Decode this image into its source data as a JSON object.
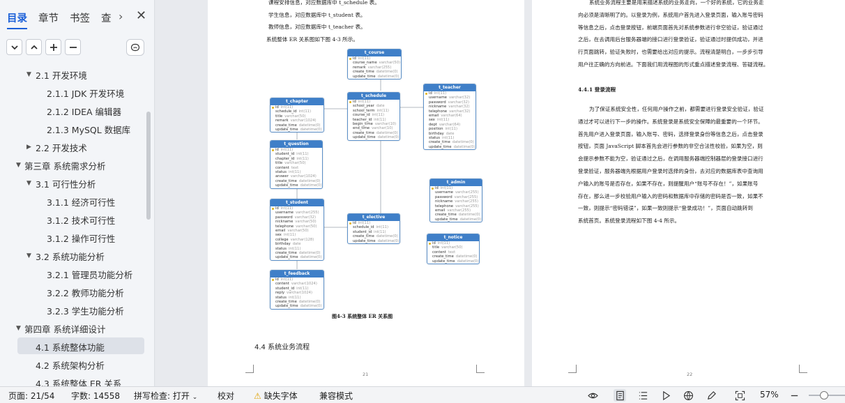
{
  "sidebar": {
    "tabs": [
      {
        "label": "目录"
      },
      {
        "label": "章节"
      },
      {
        "label": "书签"
      },
      {
        "label": "查"
      }
    ],
    "toc": [
      {
        "label": "2.1  开发环境",
        "level": 2,
        "expanded": true
      },
      {
        "label": "2.1.1 JDK 开发环境",
        "level": 3
      },
      {
        "label": "2.1.2 IDEA 编辑器",
        "level": 3
      },
      {
        "label": "2.1.3 MySQL 数据库",
        "level": 3
      },
      {
        "label": "2.2  开发技术",
        "level": 2,
        "expanded": false
      },
      {
        "label": "第三章  系统需求分析",
        "level": 1,
        "expanded": true
      },
      {
        "label": "3.1  可行性分析",
        "level": 2,
        "expanded": true
      },
      {
        "label": "3.1.1  经济可行性",
        "level": 3
      },
      {
        "label": "3.1.2  技术可行性",
        "level": 3
      },
      {
        "label": "3.1.2  操作可行性",
        "level": 3
      },
      {
        "label": "3.2  系统功能分析",
        "level": 2,
        "expanded": true
      },
      {
        "label": "3.2.1  管理员功能分析",
        "level": 3
      },
      {
        "label": "3.2.2  教师功能分析",
        "level": 3
      },
      {
        "label": "3.2.3  学生功能分析",
        "level": 3
      },
      {
        "label": "第四章  系统详细设计",
        "level": 1,
        "expanded": true
      },
      {
        "label": "4.1  系统整体功能",
        "level": 2,
        "selected": true
      },
      {
        "label": "4.2  系统架构分析",
        "level": 2
      },
      {
        "label": "4.3  系统整体 ER 关系",
        "level": 2
      }
    ]
  },
  "page21": {
    "lines": [
      "课程安排信息，对应数据库中 t_schedule 表。",
      "学生信息，对应数据库中 t_student 表。",
      "教师信息，对应数据库中 t_teacher 表。",
      "系统整体 ER 关系图如下图 4-3 所示。"
    ],
    "caption": "图4-3  系统整体 ER 关系图",
    "heading": "4.4  系统业务流程",
    "page_number": "21"
  },
  "er_tables": [
    {
      "name": "t_course",
      "fields": [
        [
          "id",
          "int(11)"
        ],
        [
          "course_name",
          "varchar(50)"
        ],
        [
          "remark",
          "varchar(255)"
        ],
        [
          "create_time",
          "datetime(0)"
        ],
        [
          "update_time",
          "datetime(0)"
        ]
      ]
    },
    {
      "name": "t_chapter",
      "fields": [
        [
          "id",
          "int(11)"
        ],
        [
          "schedule_id",
          "int(11)"
        ],
        [
          "title",
          "varchar(50)"
        ],
        [
          "remark",
          "varchar(1024)"
        ],
        [
          "create_time",
          "datetime(0)"
        ],
        [
          "update_time",
          "datetime(0)"
        ]
      ]
    },
    {
      "name": "t_schedule",
      "fields": [
        [
          "id",
          "int(11)"
        ],
        [
          "school_year",
          "date"
        ],
        [
          "school_term",
          "int(11)"
        ],
        [
          "course_id",
          "int(11)"
        ],
        [
          "teacher_id",
          "int(11)"
        ],
        [
          "begin_time",
          "varchar(10)"
        ],
        [
          "end_time",
          "varchar(10)"
        ],
        [
          "create_time",
          "datetime(0)"
        ],
        [
          "update_time",
          "datetime(0)"
        ]
      ]
    },
    {
      "name": "t_teacher",
      "fields": [
        [
          "id",
          "int(11)"
        ],
        [
          "username",
          "varchar(32)"
        ],
        [
          "password",
          "varchar(32)"
        ],
        [
          "nickname",
          "varchar(32)"
        ],
        [
          "telephone",
          "varchar(32)"
        ],
        [
          "email",
          "varchar(64)"
        ],
        [
          "sex",
          "int(11)"
        ],
        [
          "dept",
          "varchar(64)"
        ],
        [
          "position",
          "int(11)"
        ],
        [
          "birthday",
          "date"
        ],
        [
          "status",
          "int(11)"
        ],
        [
          "create_time",
          "datetime(0)"
        ],
        [
          "update_time",
          "datetime(0)"
        ]
      ]
    },
    {
      "name": "t_question",
      "fields": [
        [
          "id",
          "int(11)"
        ],
        [
          "student_id",
          "int(11)"
        ],
        [
          "chapter_id",
          "int(11)"
        ],
        [
          "title",
          "varchar(50)"
        ],
        [
          "content",
          "text"
        ],
        [
          "status",
          "int(11)"
        ],
        [
          "answer",
          "varchar(1024)"
        ],
        [
          "create_time",
          "datetime(0)"
        ],
        [
          "update_time",
          "datetime(0)"
        ]
      ]
    },
    {
      "name": "t_admin",
      "fields": [
        [
          "id",
          "int(11)"
        ],
        [
          "username",
          "varchar(255)"
        ],
        [
          "password",
          "varchar(255)"
        ],
        [
          "nickname",
          "varchar(255)"
        ],
        [
          "telephone",
          "varchar(255)"
        ],
        [
          "email",
          "varchar(255)"
        ],
        [
          "create_time",
          "datetime(0)"
        ],
        [
          "update_time",
          "datetime(0)"
        ]
      ]
    },
    {
      "name": "t_student",
      "fields": [
        [
          "id",
          "int(11)"
        ],
        [
          "username",
          "varchar(255)"
        ],
        [
          "password",
          "varchar(32)"
        ],
        [
          "nickname",
          "varchar(50)"
        ],
        [
          "telephone",
          "varchar(50)"
        ],
        [
          "email",
          "varchar(50)"
        ],
        [
          "sex",
          "int(11)"
        ],
        [
          "college",
          "varchar(128)"
        ],
        [
          "birthday",
          "date"
        ],
        [
          "status",
          "int(11)"
        ],
        [
          "create_time",
          "datetime(0)"
        ],
        [
          "update_time",
          "datetime(0)"
        ]
      ]
    },
    {
      "name": "t_elective",
      "fields": [
        [
          "id",
          "int(11)"
        ],
        [
          "schedule_id",
          "int(11)"
        ],
        [
          "student_id",
          "int(11)"
        ],
        [
          "create_time",
          "datetime(0)"
        ],
        [
          "update_time",
          "datetime(0)"
        ]
      ]
    },
    {
      "name": "t_notice",
      "fields": [
        [
          "id",
          "int(11)"
        ],
        [
          "title",
          "varchar(50)"
        ],
        [
          "content",
          "text"
        ],
        [
          "create_time",
          "datetime(0)"
        ],
        [
          "update_time",
          "datetime(0)"
        ]
      ]
    },
    {
      "name": "t_feedback",
      "fields": [
        [
          "id",
          "int(11)"
        ],
        [
          "content",
          "varchar(1024)"
        ],
        [
          "student_id",
          "int(11)"
        ],
        [
          "reply",
          "varchar(1024)"
        ],
        [
          "status",
          "int(11)"
        ],
        [
          "create_time",
          "datetime(0)"
        ],
        [
          "update_time",
          "datetime(0)"
        ]
      ]
    }
  ],
  "page22": {
    "intro_lines": [
      "系统业务流程主要是用来描述系统的业务走向，一个好的系统，它的业务走",
      "向必须是清晰明了的。以登录为例，系统用户首先进入登录页面，输入账号密码",
      "等信息之后，点击登录按钮，前端页面首先对系统参数进行非空验证，验证通过",
      "之后，在去调用后台服务器端的接口进行登录验证，验证通过时提供成功，并进",
      "行页面跳转，验证失败时，也需要给出对应的提示。流程清楚明白，一步步引导",
      "用户往正确的方向前进。下面我们用流程图的形式重点描述登录流程、答疑流程。"
    ],
    "subheading": "4.4.1 登录流程",
    "body_lines": [
      "为了保证系统安全性，任何用户操作之前，都需要进行登录安全验证，验证",
      "通过才可以进行下一步的操作。系统登录是系统安全保障的最重要的一个环节。",
      "首先用户进入登录页面，输入账号、密码，选择登录身份等信息之后，点击登录",
      "按钮，页面 JavaScript 脚本首先会进行参数的非空合法性校验，如果为空，则",
      "会提示参数不能为空，验证通过之后，在调用服务器端控制器层的登录接口进行",
      "登录验证，服务器端先根据用户登录时选择的身份，去对应的数据库表中查询用",
      "户输入的账号是否存在，如果不存在，则提醒用户“账号不存在！”，如果账号",
      "存在，那么进一步校验用户输入的密码和数据库中存储的密码是否一致，如果不",
      "一致，则提示“密码错误”，如果一致则提示“登录成功！”，页面自动跳转到",
      "系统首页。系统登录流程如下图 4-4 所示。"
    ],
    "page_number": "22"
  },
  "statusbar": {
    "page": "页面: 21/54",
    "words": "字数: 14558",
    "spellcheck": "拼写检查: 打开",
    "proofread": "校对",
    "missing_fonts": "缺失字体",
    "compat_mode": "兼容模式",
    "zoom": "57%",
    "zoom_fraction": 0.57
  }
}
